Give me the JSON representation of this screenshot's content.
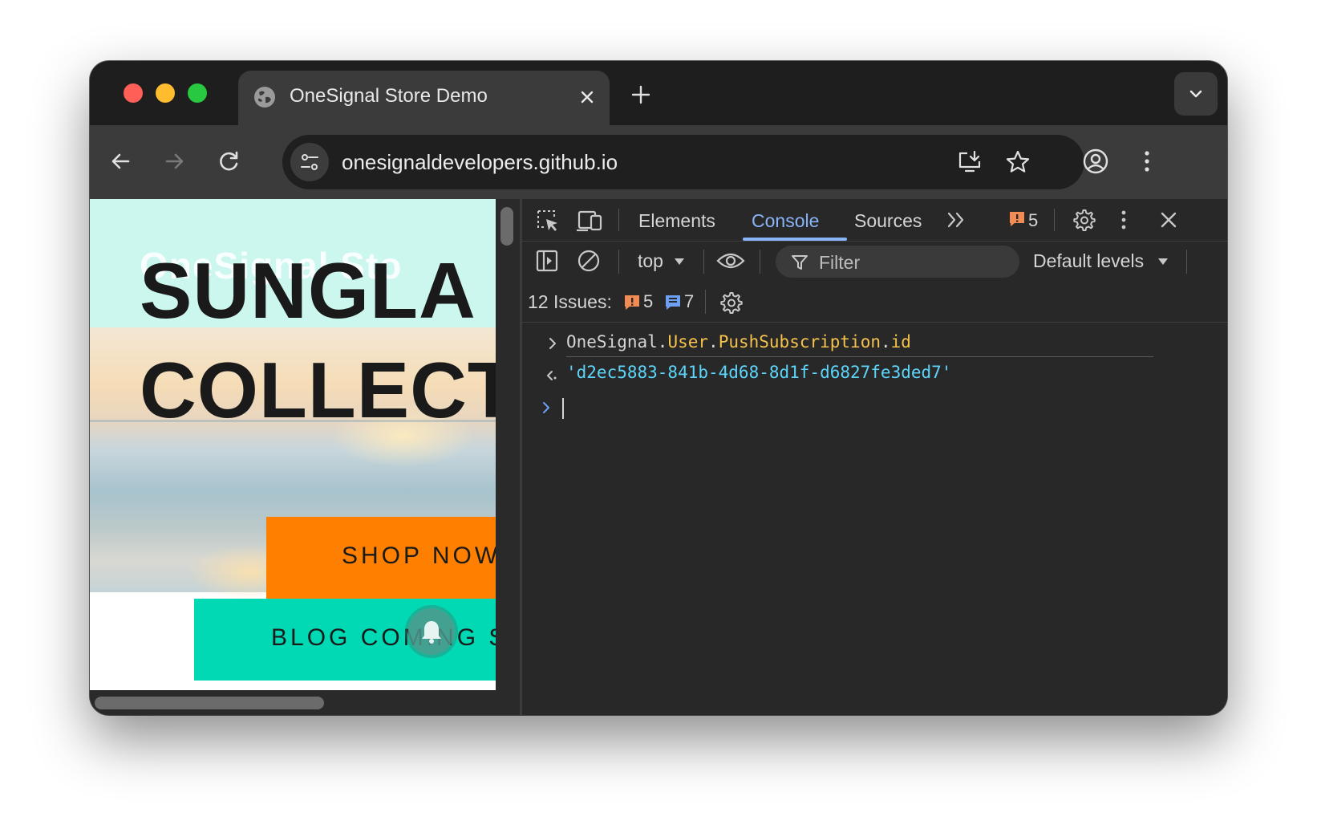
{
  "tab": {
    "title": "OneSignal Store Demo"
  },
  "address_bar": {
    "url": "onesignaldevelopers.github.io"
  },
  "page": {
    "faint_logo": "OneSignal Sto",
    "hero_title_line1": "SUNGLA",
    "hero_title_line2": "COLLECT",
    "shop_button": "SHOP NOW",
    "blog_button": "BLOG COMING S"
  },
  "devtools": {
    "tabs": [
      "Elements",
      "Console",
      "Sources"
    ],
    "active_tab": "Console",
    "error_count": "5",
    "context": "top",
    "filter_placeholder": "Filter",
    "levels": "Default levels",
    "issues_label": "12 Issues:",
    "issues_errors": "5",
    "issues_info": "7",
    "console": {
      "input": {
        "obj": "OneSignal",
        "dot1": ".",
        "p1": "User",
        "dot2": ".",
        "p2": "PushSubscription",
        "dot3": ".",
        "p3": "id"
      },
      "output": "'d2ec5883-841b-4d68-8d1f-d6827fe3ded7'"
    }
  },
  "colors": {
    "accent_blue": "#8ab4f8",
    "string_cyan": "#5cd5fb",
    "property_yellow": "#f5c34b",
    "error_orange": "#f28b54",
    "shop_orange": "#ff7f00",
    "blog_teal": "#00d9b3"
  }
}
